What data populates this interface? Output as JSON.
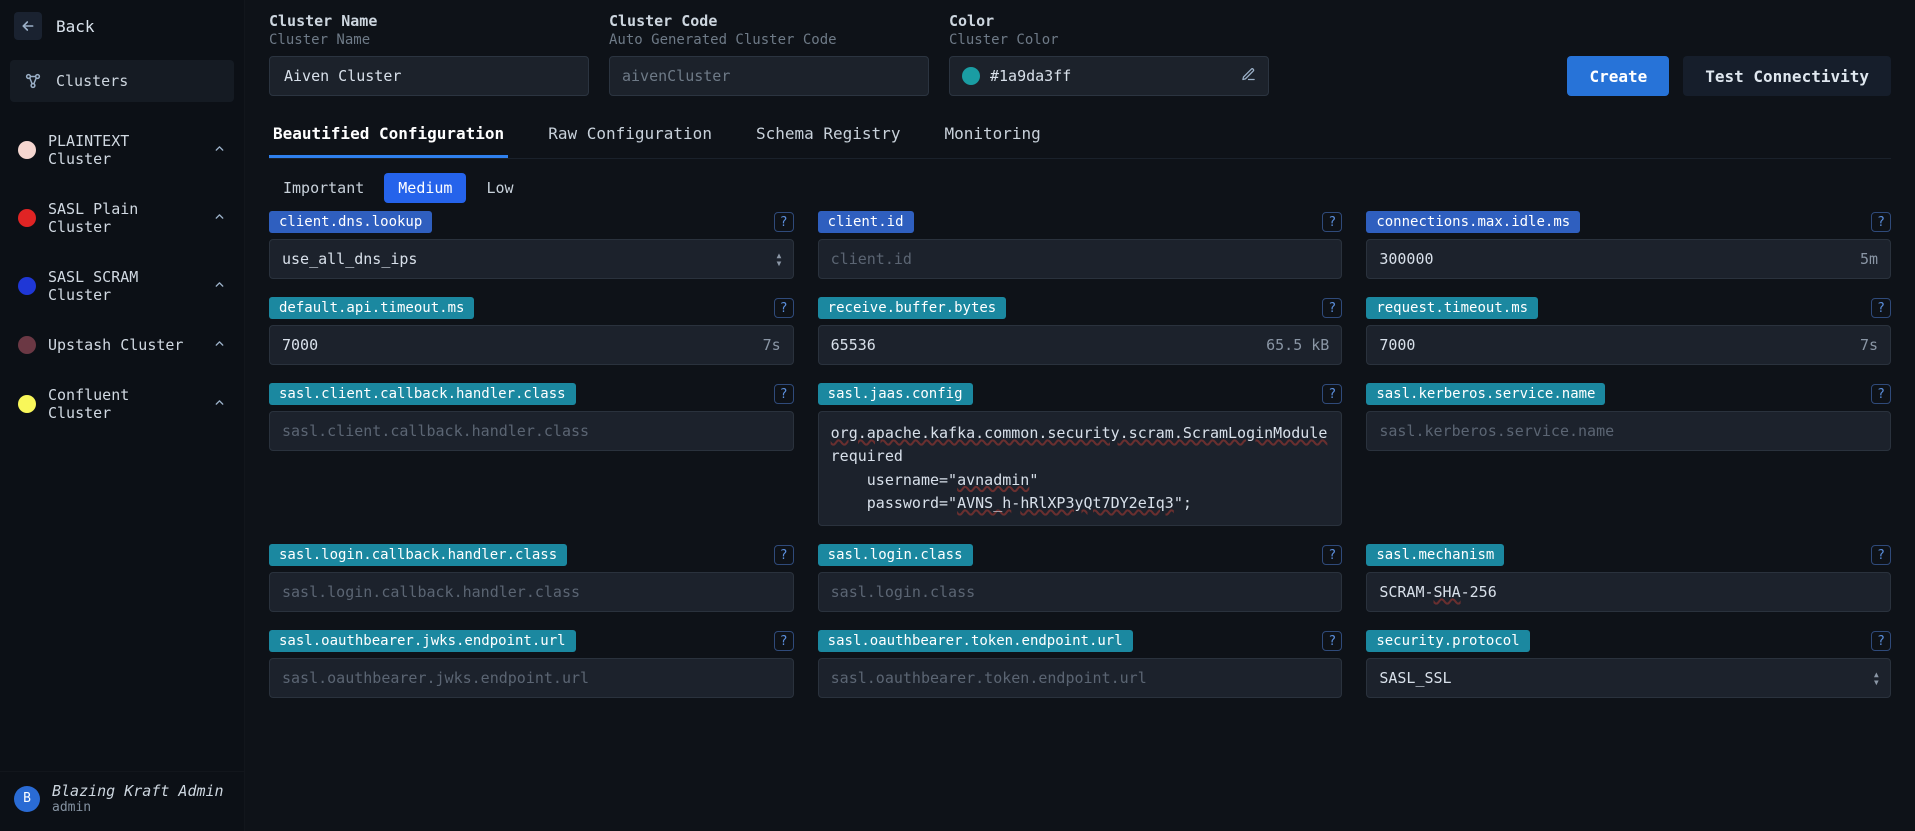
{
  "sidebar": {
    "back_label": "Back",
    "section_label": "Clusters",
    "items": [
      {
        "label": "PLAINTEXT Cluster",
        "color": "#f5d6d0"
      },
      {
        "label": "SASL Plain Cluster",
        "color": "#e02424"
      },
      {
        "label": "SASL SCRAM Cluster",
        "color": "#1f37d6"
      },
      {
        "label": "Upstash Cluster",
        "color": "#6b3844"
      },
      {
        "label": "Confluent Cluster",
        "color": "#f9f75a"
      }
    ]
  },
  "footer": {
    "avatar_letter": "B",
    "name": "Blazing Kraft Admin",
    "role": "admin"
  },
  "header": {
    "cluster_name_label": "Cluster Name",
    "cluster_name_sub": "Cluster Name",
    "cluster_name_value": "Aiven Cluster",
    "cluster_code_label": "Cluster Code",
    "cluster_code_sub": "Auto Generated Cluster Code",
    "cluster_code_placeholder": "aivenCluster",
    "color_label": "Color",
    "color_sub": "Cluster Color",
    "color_value": "#1a9da3ff",
    "color_swatch": "#1a9da3",
    "create_label": "Create",
    "test_label": "Test Connectivity"
  },
  "tabs": [
    "Beautified Configuration",
    "Raw Configuration",
    "Schema Registry",
    "Monitoring"
  ],
  "subtabs": [
    "Important",
    "Medium",
    "Low"
  ],
  "config": {
    "rows": [
      [
        {
          "key": "client.dns.lookup",
          "chip": "blue",
          "type": "select",
          "value": "use_all_dns_ips"
        },
        {
          "key": "client.id",
          "chip": "blue",
          "type": "text",
          "placeholder": "client.id"
        },
        {
          "key": "connections.max.idle.ms",
          "chip": "blue",
          "type": "text",
          "value": "300000",
          "suffix": "5m"
        }
      ],
      [
        {
          "key": "default.api.timeout.ms",
          "chip": "teal",
          "type": "text",
          "value": "7000",
          "suffix": "7s"
        },
        {
          "key": "receive.buffer.bytes",
          "chip": "teal",
          "type": "text",
          "value": "65536",
          "suffix": "65.5 kB"
        },
        {
          "key": "request.timeout.ms",
          "chip": "teal",
          "type": "text",
          "value": "7000",
          "suffix": "7s"
        }
      ],
      [
        {
          "key": "sasl.client.callback.handler.class",
          "chip": "teal",
          "type": "text",
          "placeholder": "sasl.client.callback.handler.class"
        },
        {
          "key": "sasl.jaas.config",
          "chip": "teal",
          "type": "textarea",
          "value": "org.apache.kafka.common.security.scram.ScramLoginModule required\n    username=\"avnadmin\"\n    password=\"AVNS_h-hRlXP3yQt7DY2eIq3\";"
        },
        {
          "key": "sasl.kerberos.service.name",
          "chip": "teal",
          "type": "text",
          "placeholder": "sasl.kerberos.service.name"
        }
      ],
      [
        {
          "key": "sasl.login.callback.handler.class",
          "chip": "teal",
          "type": "text",
          "placeholder": "sasl.login.callback.handler.class"
        },
        {
          "key": "sasl.login.class",
          "chip": "teal",
          "type": "text",
          "placeholder": "sasl.login.class"
        },
        {
          "key": "sasl.mechanism",
          "chip": "teal",
          "type": "text",
          "value": "SCRAM-SHA-256"
        }
      ],
      [
        {
          "key": "sasl.oauthbearer.jwks.endpoint.url",
          "chip": "teal",
          "type": "text",
          "placeholder": "sasl.oauthbearer.jwks.endpoint.url"
        },
        {
          "key": "sasl.oauthbearer.token.endpoint.url",
          "chip": "teal",
          "type": "text",
          "placeholder": "sasl.oauthbearer.token.endpoint.url"
        },
        {
          "key": "security.protocol",
          "chip": "teal",
          "type": "select",
          "value": "SASL_SSL"
        }
      ]
    ]
  }
}
